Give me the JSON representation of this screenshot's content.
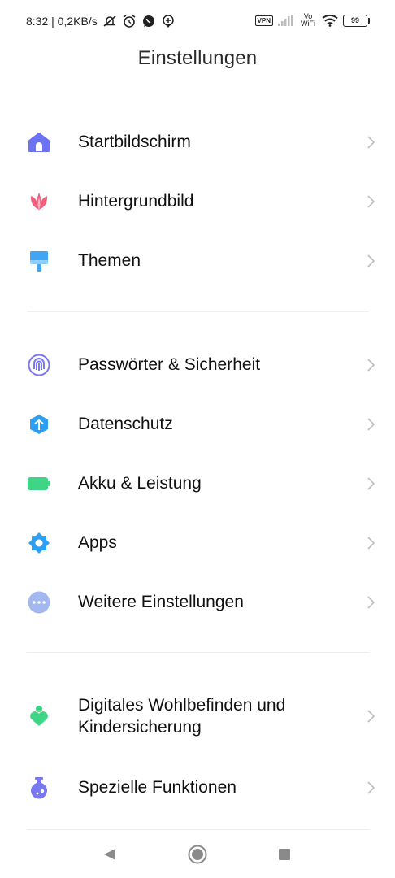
{
  "status_bar": {
    "time_and_speed": "8:32 | 0,2KB/s",
    "vpn": "VPN",
    "vowifi_top": "Vo",
    "vowifi_bottom": "WiFi",
    "battery": "99"
  },
  "header": {
    "title": "Einstellungen"
  },
  "settings": {
    "items": [
      {
        "label": "Startbildschirm",
        "icon": "home-icon",
        "color": "#6b73f2"
      },
      {
        "label": "Hintergrundbild",
        "icon": "tulip-icon",
        "color": "#f0607c"
      },
      {
        "label": "Themen",
        "icon": "paint-brush-icon",
        "color": "#3ea6f5"
      },
      {
        "label": "Passwörter & Sicherheit",
        "icon": "fingerprint-icon",
        "color": "#7a78f0"
      },
      {
        "label": "Datenschutz",
        "icon": "privacy-shield-icon",
        "color": "#2f9ff2"
      },
      {
        "label": "Akku & Leistung",
        "icon": "battery-icon",
        "color": "#3ed686"
      },
      {
        "label": "Apps",
        "icon": "gear-icon",
        "color": "#2f9ff2"
      },
      {
        "label": "Weitere Einstellungen",
        "icon": "more-dots-icon",
        "color": "#a2b8ee"
      },
      {
        "label": "Digitales Wohlbefinden und Kindersicherung",
        "icon": "wellbeing-icon",
        "color": "#3ed686"
      },
      {
        "label": "Spezielle Funktionen",
        "icon": "potion-icon",
        "color": "#7a78f0"
      }
    ]
  },
  "nav_bar": {
    "back": "back-icon",
    "home": "home-button-icon",
    "recents": "recents-icon"
  }
}
